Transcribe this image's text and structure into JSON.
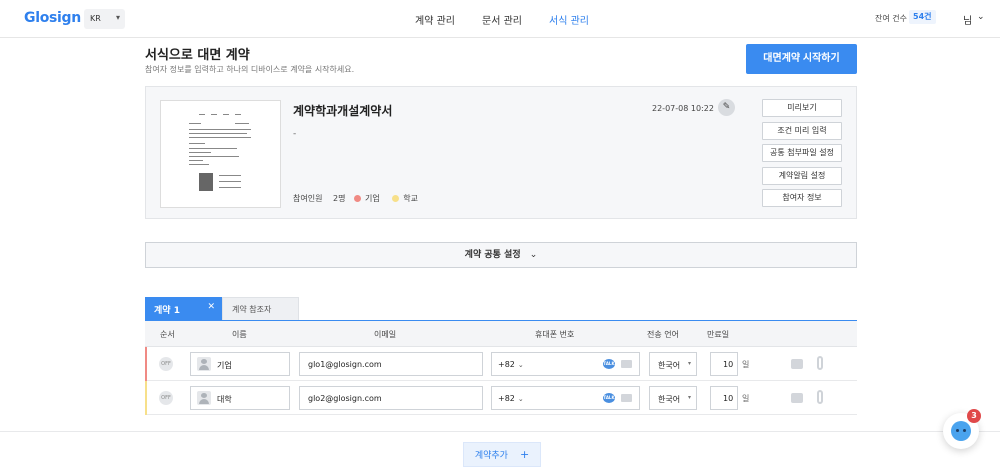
{
  "header": {
    "logo": "Glosign",
    "lang": "KR",
    "nav": [
      "계약 관리",
      "문서 관리",
      "서식 관리"
    ],
    "remain_label": "잔여 건수",
    "remain_count": "54건",
    "user": "님"
  },
  "page": {
    "title": "서식으로 대면 계약",
    "subtitle": "참여자 정보를 입력하고 하나의 디바이스로 계약을 시작하세요.",
    "start_button": "대면계약 시작하기"
  },
  "template": {
    "title": "계약학과개설계약서",
    "description": "-",
    "date": "22-07-08 10:22",
    "participants_label": "참여인원",
    "participants_count": "2명",
    "party1": "기업",
    "party1_color": "#f08a84",
    "party2": "학교",
    "party2_color": "#f7e08a",
    "buttons": [
      "미리보기",
      "조건 미리 입력",
      "공통 첨부파일 설정",
      "계약알림 설정",
      "참여자 정보"
    ]
  },
  "common_settings": "계약 공통 설정",
  "tabs": {
    "active": "계약 1",
    "other": "계약 참조자"
  },
  "table": {
    "headers": [
      "순서",
      "이름",
      "이메일",
      "휴대폰 번호",
      "전송 언어",
      "만료일"
    ],
    "rows": [
      {
        "order": "OFF",
        "name": "기업",
        "email": "glo1@glosign.com",
        "phone_code": "+82",
        "language": "한국어",
        "expire": "10",
        "unit": "일",
        "color": "#f08a84"
      },
      {
        "order": "OFF",
        "name": "대학",
        "email": "glo2@glosign.com",
        "phone_code": "+82",
        "language": "한국어",
        "expire": "10",
        "unit": "일",
        "color": "#f7e08a"
      }
    ]
  },
  "add_contract": "계약추가",
  "chat_badge": "3"
}
